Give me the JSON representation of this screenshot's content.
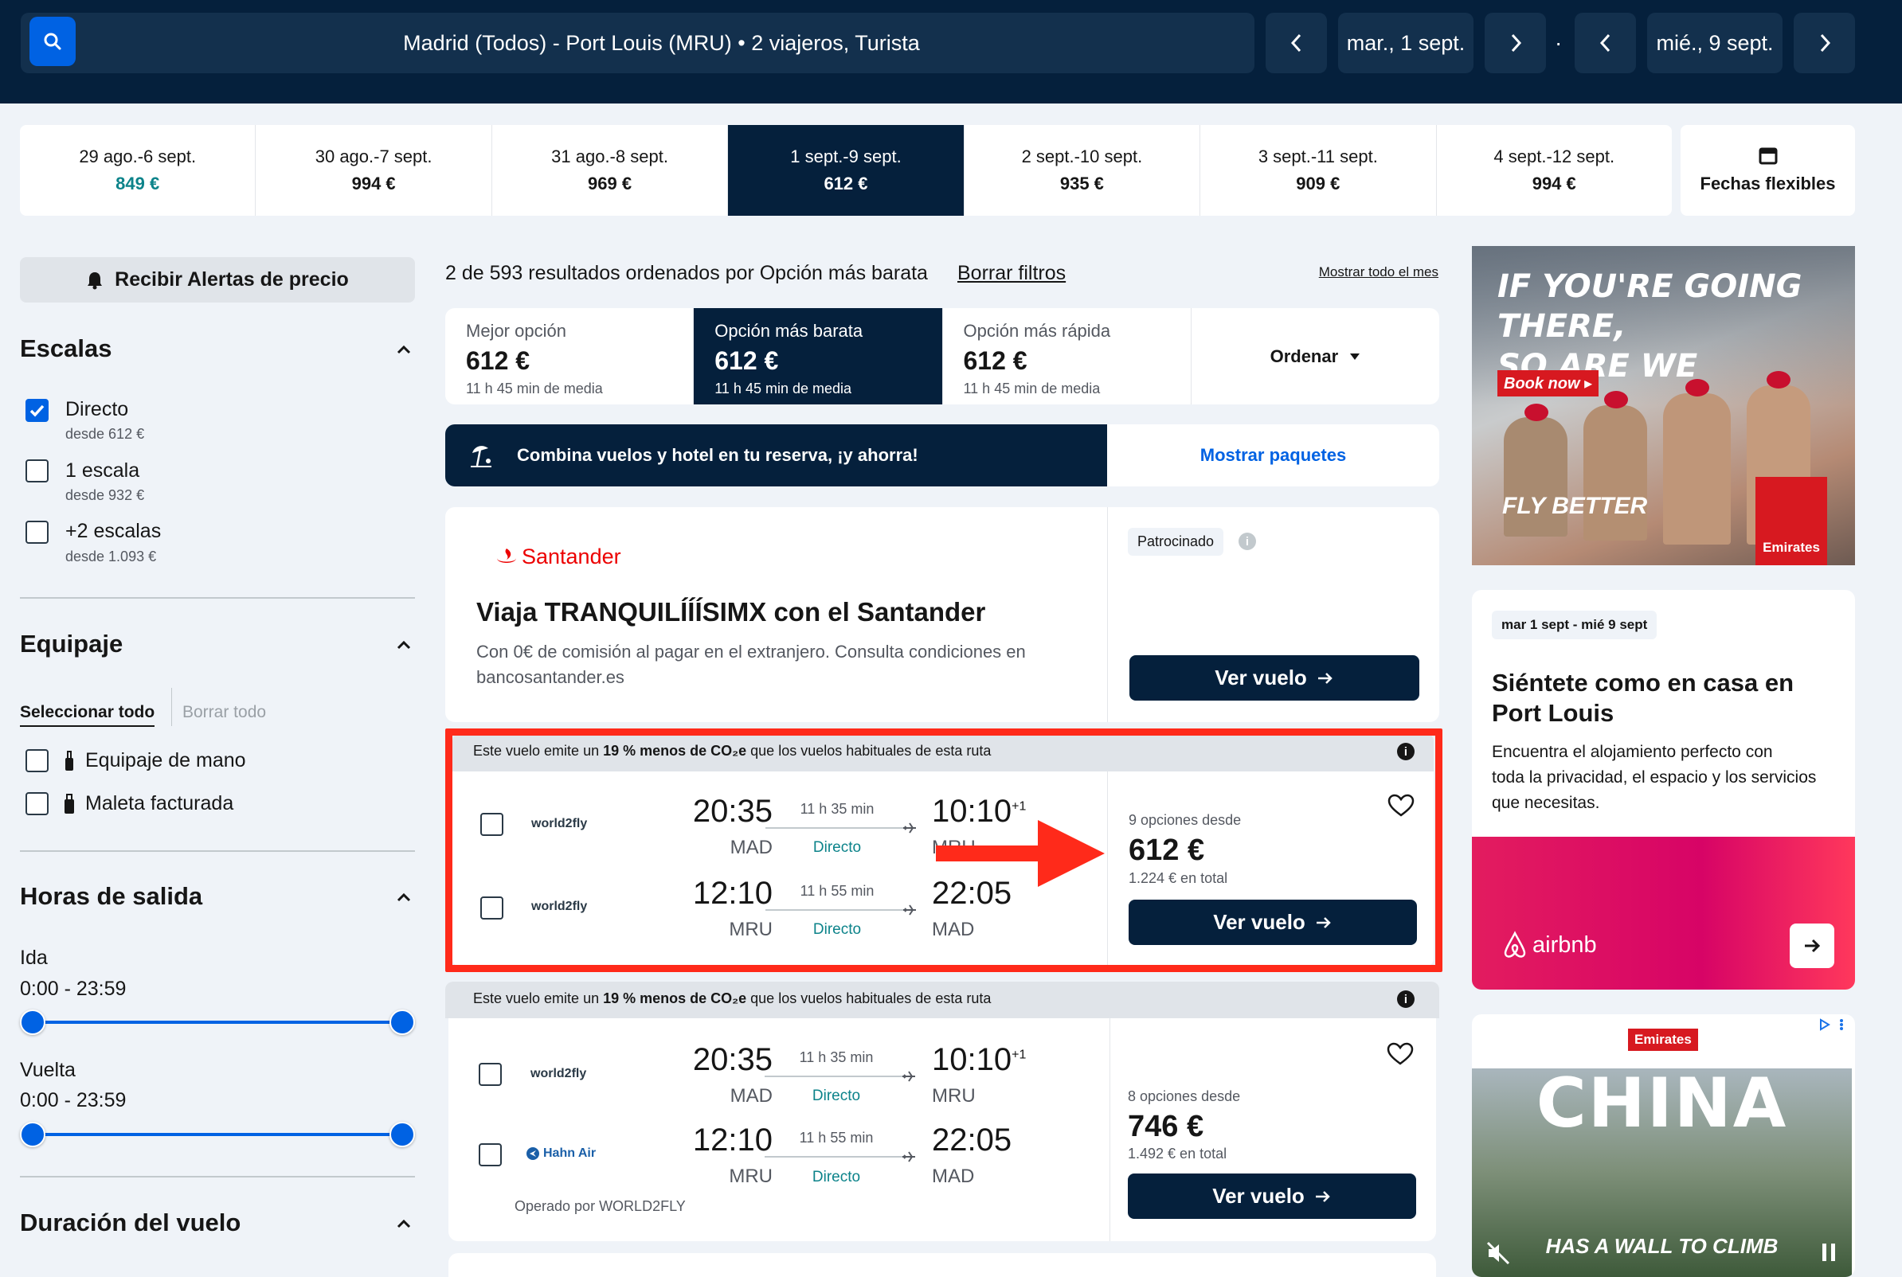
{
  "header": {
    "search": "Madrid (Todos) - Port Louis (MRU)  •  2 viajeros, Turista",
    "depart_date": "mar., 1 sept.",
    "return_date": "mié., 9 sept.",
    "separator": "·"
  },
  "date_strip": [
    {
      "range": "29 ago.-6 sept.",
      "price": "849 €"
    },
    {
      "range": "30 ago.-7 sept.",
      "price": "994 €"
    },
    {
      "range": "31 ago.-8 sept.",
      "price": "969 €"
    },
    {
      "range": "1 sept.-9 sept.",
      "price": "612 €"
    },
    {
      "range": "2 sept.-10 sept.",
      "price": "935 €"
    },
    {
      "range": "3 sept.-11 sept.",
      "price": "909 €"
    },
    {
      "range": "4 sept.-12 sept.",
      "price": "994 €"
    }
  ],
  "flexible_dates": "Fechas flexibles",
  "sidebar": {
    "alert_button": "Recibir Alertas de precio",
    "stops": {
      "title": "Escalas",
      "options": [
        {
          "label": "Directo",
          "sub": "desde 612 €",
          "checked": true
        },
        {
          "label": "1 escala",
          "sub": "desde 932 €",
          "checked": false
        },
        {
          "label": "+2 escalas",
          "sub": "desde 1.093 €",
          "checked": false
        }
      ]
    },
    "baggage": {
      "title": "Equipaje",
      "select_all": "Seleccionar todo",
      "clear_all": "Borrar todo",
      "options": [
        "Equipaje de mano",
        "Maleta facturada"
      ]
    },
    "times": {
      "title": "Horas de salida",
      "outbound_label": "Ida",
      "outbound_range": "0:00 - 23:59",
      "return_label": "Vuelta",
      "return_range": "0:00 - 23:59"
    },
    "duration_title": "Duración del vuelo"
  },
  "results": {
    "summary": "2 de 593 resultados ordenados por Opción más barata",
    "clear_filters": "Borrar filtros",
    "show_month": "Mostrar todo el mes",
    "sort_tabs": [
      {
        "title": "Mejor opción",
        "price": "612 €",
        "meta": "11 h 45 min de media"
      },
      {
        "title": "Opción más barata",
        "price": "612 €",
        "meta": "11 h 45 min de media"
      },
      {
        "title": "Opción más rápida",
        "price": "612 €",
        "meta": "11 h 45 min de media"
      }
    ],
    "sort_label": "Ordenar",
    "combo_text": "Combina vuelos y hotel en tu reserva, ¡y ahorra!",
    "combo_link": "Mostrar paquetes"
  },
  "sponsored": {
    "brand": "Santander",
    "badge": "Patrocinado",
    "title": "Viaja TRANQUILÍÍÍSIMX con el Santander",
    "body_line1": "Con 0€ de comisión al pagar en el extranjero. Consulta condiciones en",
    "body_line2": "bancosantander.es",
    "button": "Ver vuelo"
  },
  "cards": [
    {
      "eco_pre": "Este vuelo emite un ",
      "eco_bold": "19 % menos de CO₂e",
      "eco_post": " que los vuelos habituales de esta ruta",
      "legs": [
        {
          "airline": "world2fly",
          "dep": "20:35",
          "dep_code": "MAD",
          "dur": "11 h 35 min",
          "stops": "Directo",
          "arr": "10:10",
          "plus": "+1",
          "arr_code": "MRU"
        },
        {
          "airline": "world2fly",
          "dep": "12:10",
          "dep_code": "MRU",
          "dur": "11 h 55 min",
          "stops": "Directo",
          "arr": "22:05",
          "plus": "",
          "arr_code": "MAD"
        }
      ],
      "options": "9 opciones desde",
      "price": "612 €",
      "total": "1.224 € en total",
      "button": "Ver vuelo"
    },
    {
      "eco_pre": "Este vuelo emite un ",
      "eco_bold": "19 % menos de CO₂e",
      "eco_post": " que los vuelos habituales de esta ruta",
      "legs": [
        {
          "airline": "world2fly",
          "dep": "20:35",
          "dep_code": "MAD",
          "dur": "11 h 35 min",
          "stops": "Directo",
          "arr": "10:10",
          "plus": "+1",
          "arr_code": "MRU"
        },
        {
          "airline": "Hahn Air",
          "dep": "12:10",
          "dep_code": "MRU",
          "dur": "11 h 55 min",
          "stops": "Directo",
          "arr": "22:05",
          "plus": "",
          "arr_code": "MAD"
        }
      ],
      "operated": "Operado por WORLD2FLY",
      "options": "8 opciones desde",
      "price": "746 €",
      "total": "1.492 € en total",
      "button": "Ver vuelo"
    }
  ],
  "ads": {
    "emirates": {
      "line1": "IF YOU'RE GOING THERE,",
      "line2": "SO ARE WE",
      "book": "Book now ▸",
      "fly": "FLY BETTER",
      "brand": "Emirates"
    },
    "hotel": {
      "dates": "mar 1 sept - mié 9 sept",
      "title_l1": "Siéntete como en casa en",
      "title_l2": "Port Louis",
      "body_l1": "Encuentra el alojamiento perfecto con",
      "body_l2": "toda la privacidad, el espacio y los servicios",
      "body_l3": "que necesitas.",
      "brand": "airbnb"
    },
    "china": {
      "brand": "Emirates",
      "title": "CHINA",
      "tagline": "HAS A WALL TO CLIMB"
    }
  },
  "colors": {
    "navy": "#05203c",
    "blue": "#0062e3",
    "teal": "#0c838a",
    "highlight": "#ff2a1a",
    "airbnb": "#e31c5f"
  }
}
